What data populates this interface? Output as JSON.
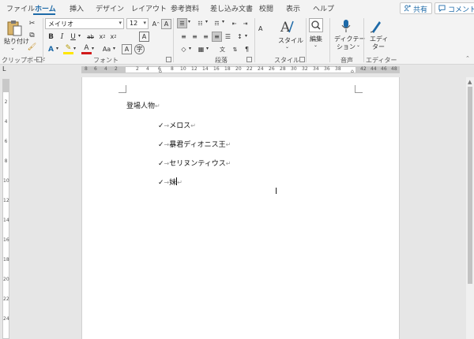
{
  "tabs": [
    {
      "label": "ファイル",
      "active": false
    },
    {
      "label": "ホーム",
      "active": true
    },
    {
      "label": "挿入",
      "active": false
    },
    {
      "label": "デザイン",
      "active": false
    },
    {
      "label": "レイアウト",
      "active": false
    },
    {
      "label": "参考資料",
      "active": false
    },
    {
      "label": "差し込み文書",
      "active": false
    },
    {
      "label": "校閲",
      "active": false
    },
    {
      "label": "表示",
      "active": false
    },
    {
      "label": "ヘルプ",
      "active": false
    }
  ],
  "share": {
    "share_label": "共有",
    "comment_label": "コメント"
  },
  "ribbon": {
    "clipboard": {
      "group_label": "クリップボード",
      "paste_label": "貼り付け"
    },
    "font": {
      "group_label": "フォント",
      "font_name": "メイリオ",
      "font_size": "12"
    },
    "paragraph": {
      "group_label": "段落"
    },
    "styles": {
      "group_label": "スタイル",
      "styles_label": "スタイル"
    },
    "editing": {
      "label": "編集"
    },
    "voice": {
      "group_label": "音声",
      "dictate_label": "ディクテー",
      "dictate_label2": "ション"
    },
    "editor": {
      "group_label": "エディター",
      "editor_label": "エディ",
      "editor_label2": "ター"
    }
  },
  "ruler": {
    "h_left_numbers": [
      "8",
      "6",
      "4",
      "2",
      "2",
      "4",
      "6",
      "8"
    ],
    "h_right_numbers": [
      "10",
      "12",
      "14",
      "16",
      "18",
      "20",
      "22",
      "24",
      "26",
      "28",
      "30",
      "32",
      "34",
      "36",
      "38",
      "42",
      "44",
      "46",
      "48"
    ],
    "v_numbers": [
      "2",
      "4",
      "6",
      "8",
      "10",
      "12",
      "14",
      "16",
      "18",
      "20",
      "22",
      "24"
    ]
  },
  "document": {
    "heading": "登場人物",
    "list_items": [
      "メロス",
      "暴君ディオニス王",
      "セリヌンティウス",
      "妹"
    ],
    "check_mark": "✓",
    "tab_arrow": "→",
    "pilcrow": "↵"
  },
  "colors": {
    "accent": "#1e6aa8",
    "ribbon_bg": "#f3f3f3",
    "canvas_bg": "#e6e6e6"
  }
}
